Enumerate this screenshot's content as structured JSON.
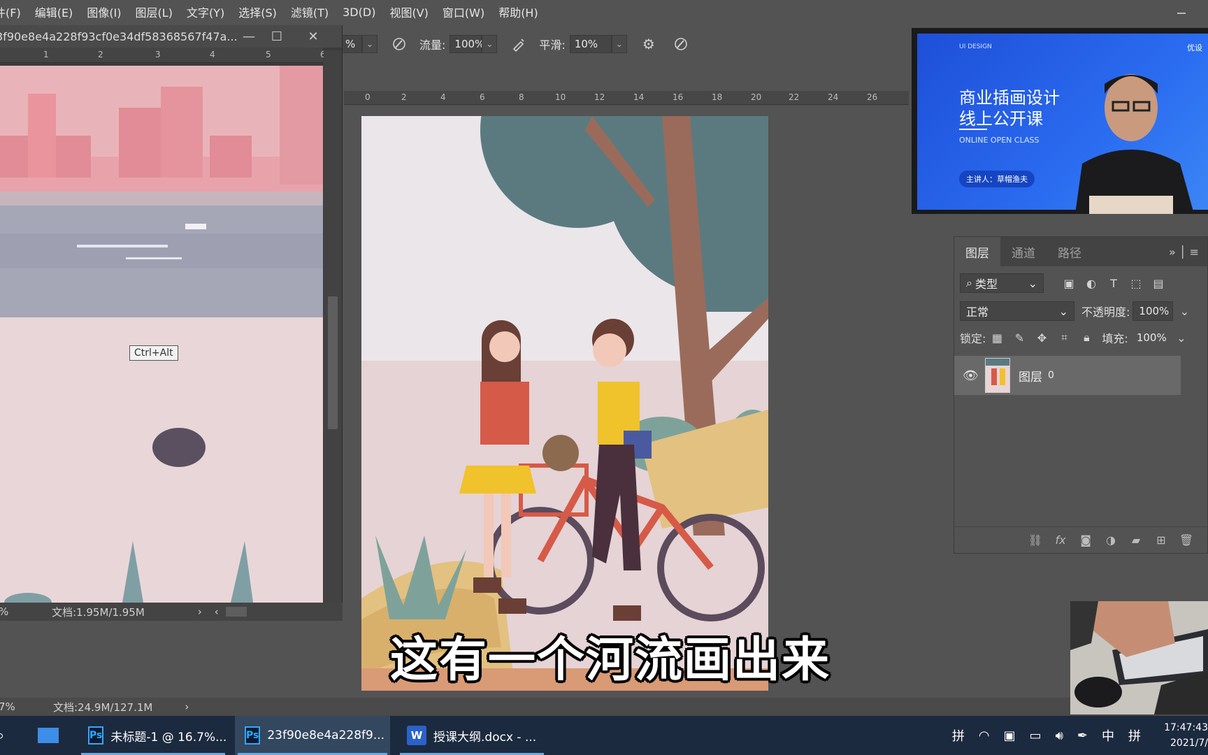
{
  "menu": [
    "件(F)",
    "编辑(E)",
    "图像(I)",
    "图层(L)",
    "文字(Y)",
    "选择(S)",
    "滤镜(T)",
    "3D(D)",
    "视图(V)",
    "窗口(W)",
    "帮助(H)"
  ],
  "options_bar": {
    "opacity_value": "%",
    "flow_label": "流量:",
    "flow_value": "100%",
    "smooth_label": "平滑:",
    "smooth_value": "10%"
  },
  "doc_window": {
    "title": "3f90e8e4a228f93cf0e34df58368567f47a...",
    "ruler_ticks": [
      "1",
      "2",
      "3",
      "4",
      "5",
      "6"
    ],
    "tooltip": "Ctrl+Alt",
    "zoom": "%",
    "doc_size": "文档:1.95M/1.95M"
  },
  "main_ruler_ticks": [
    "0",
    "2",
    "4",
    "6",
    "8",
    "10",
    "12",
    "14",
    "16",
    "18",
    "20",
    "22",
    "24",
    "26"
  ],
  "subtitle": "这有一个河流画出来",
  "video": {
    "tag": "UI DESIGN",
    "title_line1": "商业插画设计",
    "title_line2": "线上公开课",
    "subtitle": "ONLINE OPEN CLASS",
    "speaker": "主讲人：草帽渔夫",
    "logo": "优设"
  },
  "layers_panel": {
    "tabs": [
      "图层",
      "通道",
      "路径"
    ],
    "active_tab": "图层",
    "filter_label": "类型",
    "blend_mode": "正常",
    "opacity_label": "不透明度:",
    "opacity_value": "100%",
    "lock_label": "锁定:",
    "fill_label": "填充:",
    "fill_value": "100%",
    "layer_name": "图层",
    "layer_number": "0"
  },
  "status_bar": {
    "zoom": "7%",
    "doc_size": "文档:24.9M/127.1M"
  },
  "taskbar": {
    "tasks": [
      {
        "icon": "Ps",
        "label": "未标题-1 @ 16.7%..."
      },
      {
        "icon": "Ps",
        "label": "23f90e8e4a228f9..."
      },
      {
        "icon": "W",
        "label": "授课大纲.docx - ..."
      }
    ],
    "tray": [
      "拼",
      "中",
      "拼"
    ],
    "time": "17:47:43",
    "date": "2021/7/"
  },
  "colors": {
    "ps_bg": "#535353",
    "taskbar": "#1c2a3f",
    "slide_blue": "#2a6bf0",
    "accent": "#31a8ff"
  }
}
